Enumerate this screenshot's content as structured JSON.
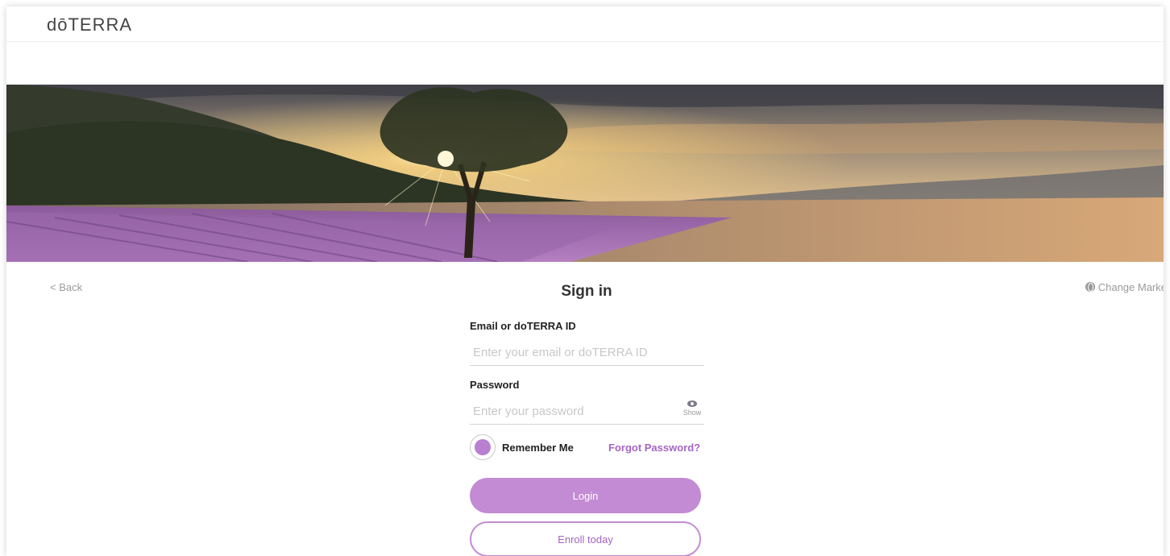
{
  "header": {
    "logo": "dōTERRA"
  },
  "nav": {
    "back_label": "< Back",
    "change_market_label": "Change Marke"
  },
  "form": {
    "title": "Sign in",
    "email_label": "Email or doTERRA ID",
    "email_placeholder": "Enter your email or doTERRA ID",
    "email_value": "",
    "password_label": "Password",
    "password_placeholder": "Enter your password",
    "password_value": "",
    "show_label": "Show",
    "remember_label": "Remember Me",
    "remember_checked": true,
    "forgot_label": "Forgot Password?",
    "login_label": "Login",
    "enroll_label": "Enroll today"
  },
  "colors": {
    "accent": "#c38bd3",
    "accent_text": "#a565c4",
    "muted_text": "#9a9a9a"
  },
  "icons": {
    "back": "chevron-left-icon",
    "market": "globe-icon",
    "show": "eye-icon"
  }
}
